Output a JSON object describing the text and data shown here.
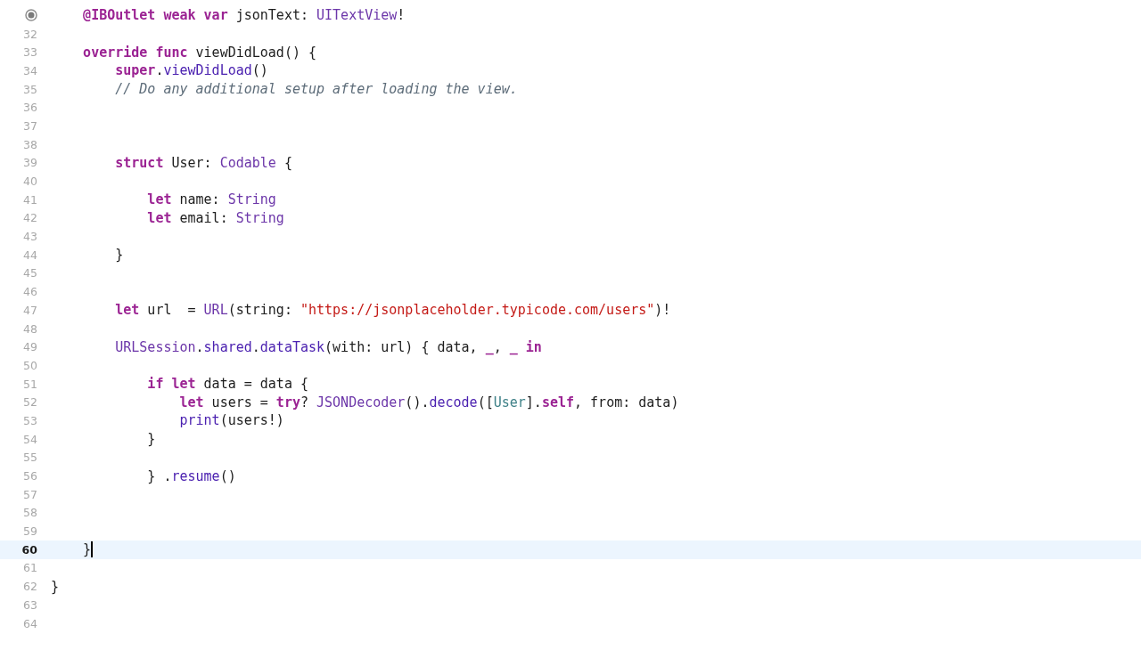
{
  "editor": {
    "lines": [
      {
        "outlet_connected": true,
        "selected": false,
        "tokens": [
          {
            "text": "    @IBOutlet weak var",
            "kind": "keyword"
          },
          {
            "text": " jsonText: ",
            "kind": "plain"
          },
          {
            "text": "UITextView",
            "kind": "type"
          },
          {
            "text": "!",
            "kind": "plain"
          }
        ]
      },
      {
        "number": "32",
        "selected": false
      },
      {
        "number": "33",
        "selected": false,
        "tokens": [
          {
            "text": "    override func",
            "kind": "keyword"
          },
          {
            "text": " viewDidLoad() {",
            "kind": "plain"
          }
        ]
      },
      {
        "number": "34",
        "selected": false,
        "tokens": [
          {
            "text": "        super",
            "kind": "keyword"
          },
          {
            "text": ".",
            "kind": "plain"
          },
          {
            "text": "viewDidLoad",
            "kind": "method"
          },
          {
            "text": "()",
            "kind": "plain"
          }
        ]
      },
      {
        "number": "35",
        "selected": false,
        "tokens": [
          {
            "text": "        // Do any additional setup after loading the view.",
            "kind": "comment"
          }
        ]
      },
      {
        "number": "36",
        "selected": false
      },
      {
        "number": "37",
        "selected": false
      },
      {
        "number": "38",
        "selected": false
      },
      {
        "number": "39",
        "selected": false,
        "tokens": [
          {
            "text": "        struct",
            "kind": "keyword"
          },
          {
            "text": " User: ",
            "kind": "plain"
          },
          {
            "text": "Codable",
            "kind": "type"
          },
          {
            "text": " {",
            "kind": "plain"
          }
        ]
      },
      {
        "number": "40",
        "selected": false
      },
      {
        "number": "41",
        "selected": false,
        "tokens": [
          {
            "text": "            let",
            "kind": "keyword"
          },
          {
            "text": " name: ",
            "kind": "plain"
          },
          {
            "text": "String",
            "kind": "type"
          }
        ]
      },
      {
        "number": "42",
        "selected": false,
        "tokens": [
          {
            "text": "            let",
            "kind": "keyword"
          },
          {
            "text": " email: ",
            "kind": "plain"
          },
          {
            "text": "String",
            "kind": "type"
          }
        ]
      },
      {
        "number": "43",
        "selected": false
      },
      {
        "number": "44",
        "selected": false,
        "tokens": [
          {
            "text": "        }",
            "kind": "plain"
          }
        ]
      },
      {
        "number": "45",
        "selected": false
      },
      {
        "number": "46",
        "selected": false
      },
      {
        "number": "47",
        "selected": false,
        "tokens": [
          {
            "text": "        let",
            "kind": "keyword"
          },
          {
            "text": " url  = ",
            "kind": "plain"
          },
          {
            "text": "URL",
            "kind": "type"
          },
          {
            "text": "(string: ",
            "kind": "plain"
          },
          {
            "text": "\"https://jsonplaceholder.typicode.com/users\"",
            "kind": "string"
          },
          {
            "text": ")!",
            "kind": "plain"
          }
        ]
      },
      {
        "number": "48",
        "selected": false
      },
      {
        "number": "49",
        "selected": false,
        "tokens": [
          {
            "text": "        URLSession",
            "kind": "type"
          },
          {
            "text": ".",
            "kind": "plain"
          },
          {
            "text": "shared",
            "kind": "method"
          },
          {
            "text": ".",
            "kind": "plain"
          },
          {
            "text": "dataTask",
            "kind": "method"
          },
          {
            "text": "(with: url) { data, ",
            "kind": "plain"
          },
          {
            "text": "_",
            "kind": "keyword"
          },
          {
            "text": ", ",
            "kind": "plain"
          },
          {
            "text": "_ in",
            "kind": "keyword"
          }
        ]
      },
      {
        "number": "50",
        "selected": false
      },
      {
        "number": "51",
        "selected": false,
        "tokens": [
          {
            "text": "            if let",
            "kind": "keyword"
          },
          {
            "text": " data = data {",
            "kind": "plain"
          }
        ]
      },
      {
        "number": "52",
        "selected": false,
        "tokens": [
          {
            "text": "                let",
            "kind": "keyword"
          },
          {
            "text": " users = ",
            "kind": "plain"
          },
          {
            "text": "try",
            "kind": "keyword"
          },
          {
            "text": "? ",
            "kind": "plain"
          },
          {
            "text": "JSONDecoder",
            "kind": "type"
          },
          {
            "text": "().",
            "kind": "plain"
          },
          {
            "text": "decode",
            "kind": "method"
          },
          {
            "text": "([",
            "kind": "plain"
          },
          {
            "text": "User",
            "kind": "local-type"
          },
          {
            "text": "].",
            "kind": "plain"
          },
          {
            "text": "self",
            "kind": "keyword"
          },
          {
            "text": ", from: data)",
            "kind": "plain"
          }
        ]
      },
      {
        "number": "53",
        "selected": false,
        "tokens": [
          {
            "text": "                print",
            "kind": "method"
          },
          {
            "text": "(users!)",
            "kind": "plain"
          }
        ]
      },
      {
        "number": "54",
        "selected": false,
        "tokens": [
          {
            "text": "            }",
            "kind": "plain"
          }
        ]
      },
      {
        "number": "55",
        "selected": false
      },
      {
        "number": "56",
        "selected": false,
        "tokens": [
          {
            "text": "            } .",
            "kind": "plain"
          },
          {
            "text": "resume",
            "kind": "method"
          },
          {
            "text": "()",
            "kind": "plain"
          }
        ]
      },
      {
        "number": "57",
        "selected": false
      },
      {
        "number": "58",
        "selected": false
      },
      {
        "number": "59",
        "selected": false
      },
      {
        "number": "60",
        "selected": true,
        "tokens": [
          {
            "text": "    }",
            "kind": "plain"
          }
        ]
      },
      {
        "number": "61",
        "selected": false
      },
      {
        "number": "62",
        "selected": false,
        "tokens": [
          {
            "text": "}",
            "kind": "plain"
          }
        ]
      },
      {
        "number": "63",
        "selected": false
      },
      {
        "number": "64",
        "selected": false
      }
    ]
  }
}
